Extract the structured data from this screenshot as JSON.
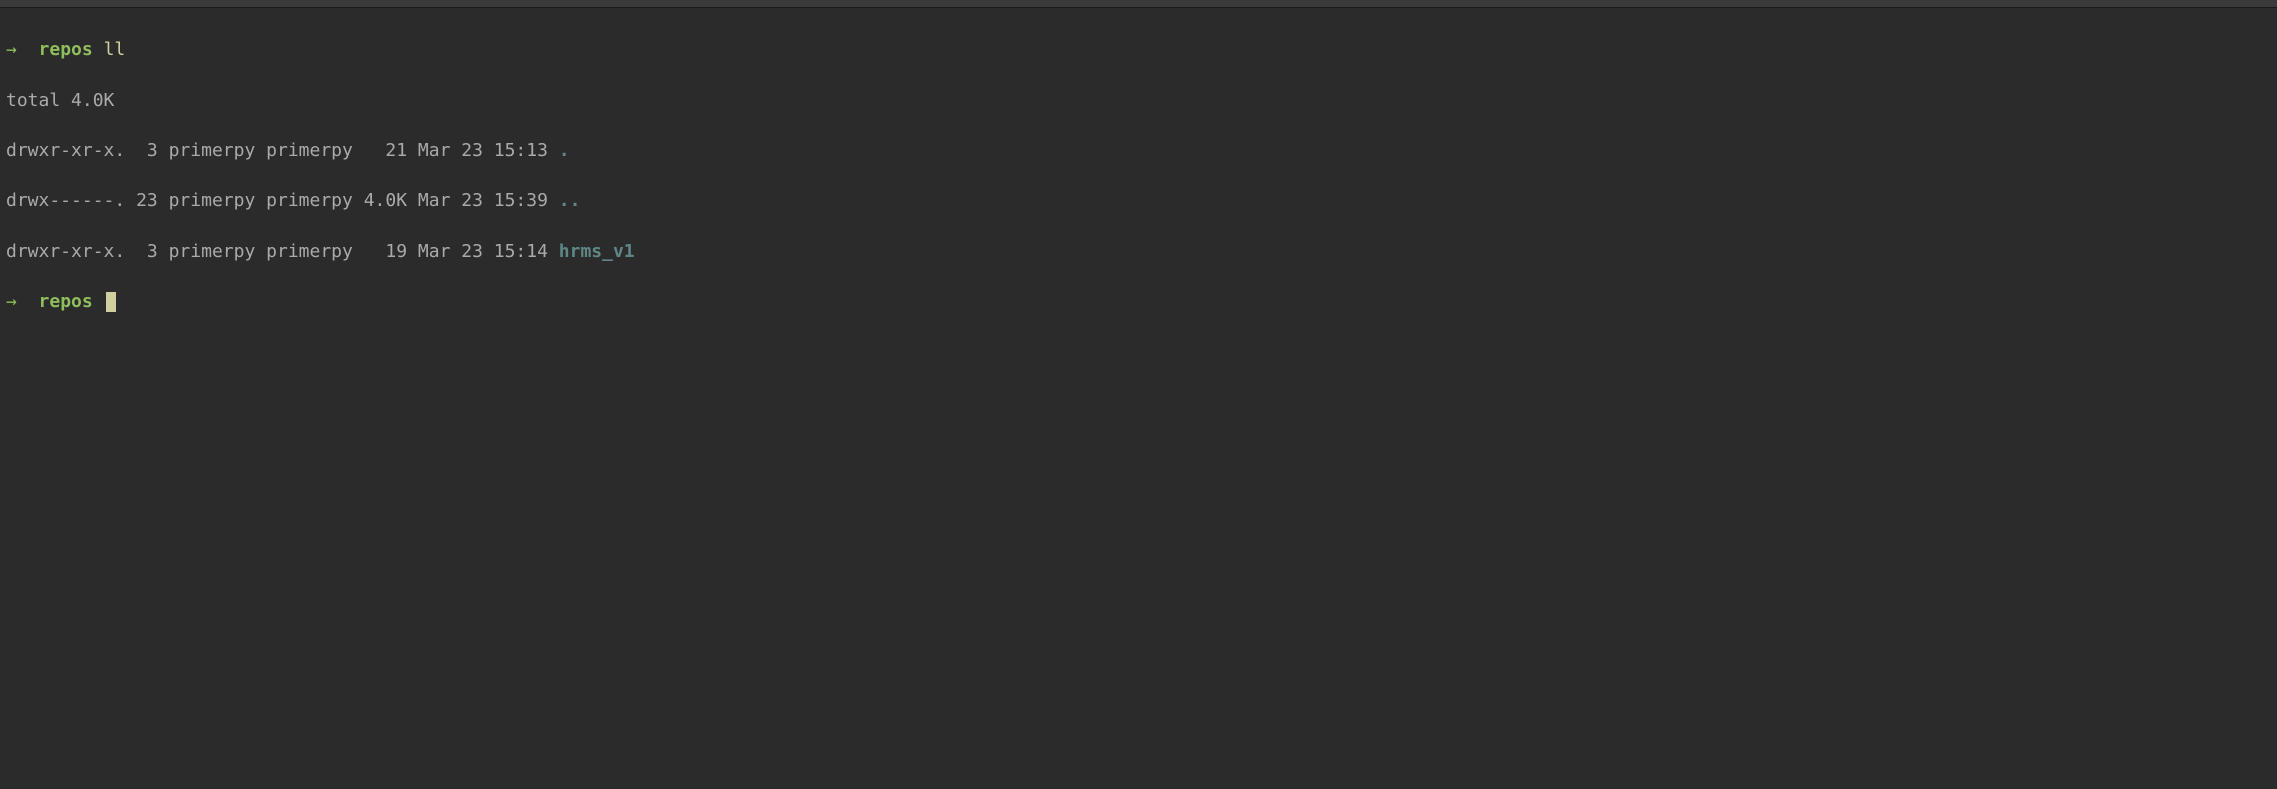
{
  "prompts": [
    {
      "arrow": "→",
      "dir": "repos",
      "cmd": "ll"
    },
    {
      "arrow": "→",
      "dir": "repos",
      "cmd": ""
    }
  ],
  "total_line": "total 4.0K",
  "listing": [
    {
      "perms": "drwxr-xr-x.",
      "links": " 3",
      "owner": "primerpy",
      "group": "primerpy",
      "size": "  21",
      "date": "Mar 23 15:13",
      "name": ".",
      "name_class": "name-dir"
    },
    {
      "perms": "drwx------.",
      "links": "23",
      "owner": "primerpy",
      "group": "primerpy",
      "size": "4.0K",
      "date": "Mar 23 15:39",
      "name": "..",
      "name_class": "name-dir"
    },
    {
      "perms": "drwxr-xr-x.",
      "links": " 3",
      "owner": "primerpy",
      "group": "primerpy",
      "size": "  19",
      "date": "Mar 23 15:14",
      "name": "hrms_v1",
      "name_class": "name-link"
    }
  ]
}
